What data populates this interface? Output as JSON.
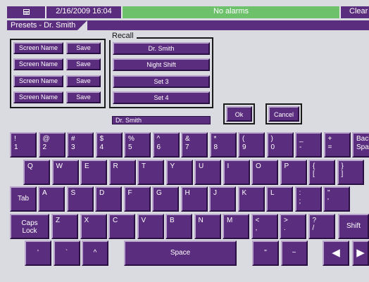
{
  "status_bar": {
    "menu_icon": "calculator-icon",
    "datetime": "2/16/2009 16:04",
    "alarm_text": "No alarms",
    "clear_label": "Clear"
  },
  "title": "Presets - Dr. Smith",
  "presets": {
    "screen_name_label": "Screen Name",
    "save_label": "Save",
    "recall_title": "Recall",
    "recall_items": [
      "Dr. Smith",
      "Night Shift",
      "Set 3",
      "Set 4"
    ]
  },
  "name_field_value": "Dr. Smith",
  "dialog": {
    "ok_label": "Ok",
    "cancel_label": "Cancel"
  },
  "keyboard": {
    "row1": [
      "!\n1",
      "@\n2",
      "#\n3",
      "$\n4",
      "%\n5",
      "^\n6",
      "&\n7",
      "*\n8",
      "(\n9",
      ")\n0",
      "_\n-",
      "+\n=",
      "Back\nSpace"
    ],
    "row2": [
      "Q",
      "W",
      "E",
      "R",
      "T",
      "Y",
      "U",
      "I",
      "O",
      "P",
      "{\n[",
      "}\n]"
    ],
    "row3_tab": "Tab",
    "row3": [
      "A",
      "S",
      "D",
      "F",
      "G",
      "H",
      "J",
      "K",
      "L",
      ":\n;",
      "\"\n'"
    ],
    "row4_caps": "Caps\nLock",
    "row4": [
      "Z",
      "X",
      "C",
      "V",
      "B",
      "N",
      "M",
      "<\n,",
      ">\n.",
      "?\n/"
    ],
    "row4_shift": "Shift",
    "row5_left": [
      "'",
      "`",
      "^"
    ],
    "space_label": "Space",
    "row5_right": [
      "\"",
      "~"
    ],
    "arrow_left_icon": "arrow-left-icon",
    "arrow_right_icon": "arrow-right-icon"
  },
  "colors": {
    "accent": "#5b2d7e",
    "alarm_ok": "#6cc16a",
    "background": "#dadbe0"
  }
}
